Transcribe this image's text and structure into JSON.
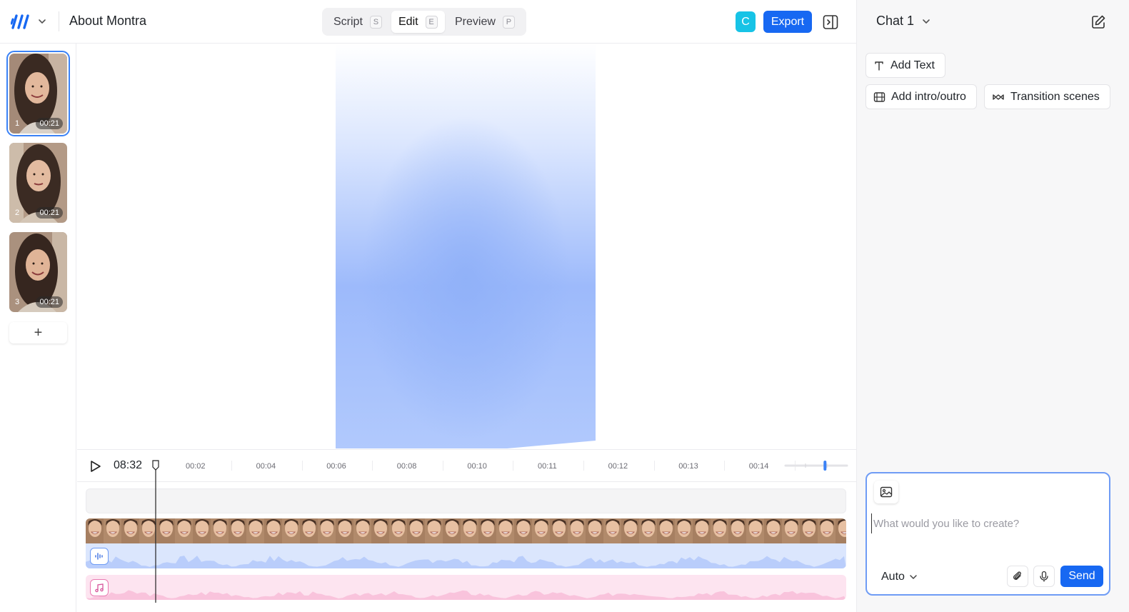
{
  "header": {
    "project_title": "About Montra",
    "modes": [
      {
        "label": "Script",
        "shortcut": "S",
        "active": false
      },
      {
        "label": "Edit",
        "shortcut": "E",
        "active": true
      },
      {
        "label": "Preview",
        "shortcut": "P",
        "active": false
      }
    ],
    "user_initial": "C",
    "export_label": "Export",
    "accent_color": "#1768f2"
  },
  "scenes": [
    {
      "number": "1",
      "duration": "00:21",
      "selected": true
    },
    {
      "number": "2",
      "duration": "00:21",
      "selected": false
    },
    {
      "number": "3",
      "duration": "00:21",
      "selected": false
    }
  ],
  "add_scene_label": "+",
  "timeline": {
    "current_time": "08:32",
    "ticks": [
      "00:02",
      "00:04",
      "00:06",
      "00:08",
      "00:10",
      "00:11",
      "00:12",
      "00:13",
      "00:14"
    ],
    "zoom_level": 0.65
  },
  "chat": {
    "title": "Chat 1",
    "actions": [
      {
        "label": "Add Text",
        "icon": "text-icon"
      },
      {
        "label": "Add intro/outro",
        "icon": "film-icon"
      },
      {
        "label": "Transition scenes",
        "icon": "infinity-icon"
      }
    ],
    "composer": {
      "placeholder": "What would you like to create?",
      "model": "Auto",
      "send_label": "Send"
    }
  }
}
